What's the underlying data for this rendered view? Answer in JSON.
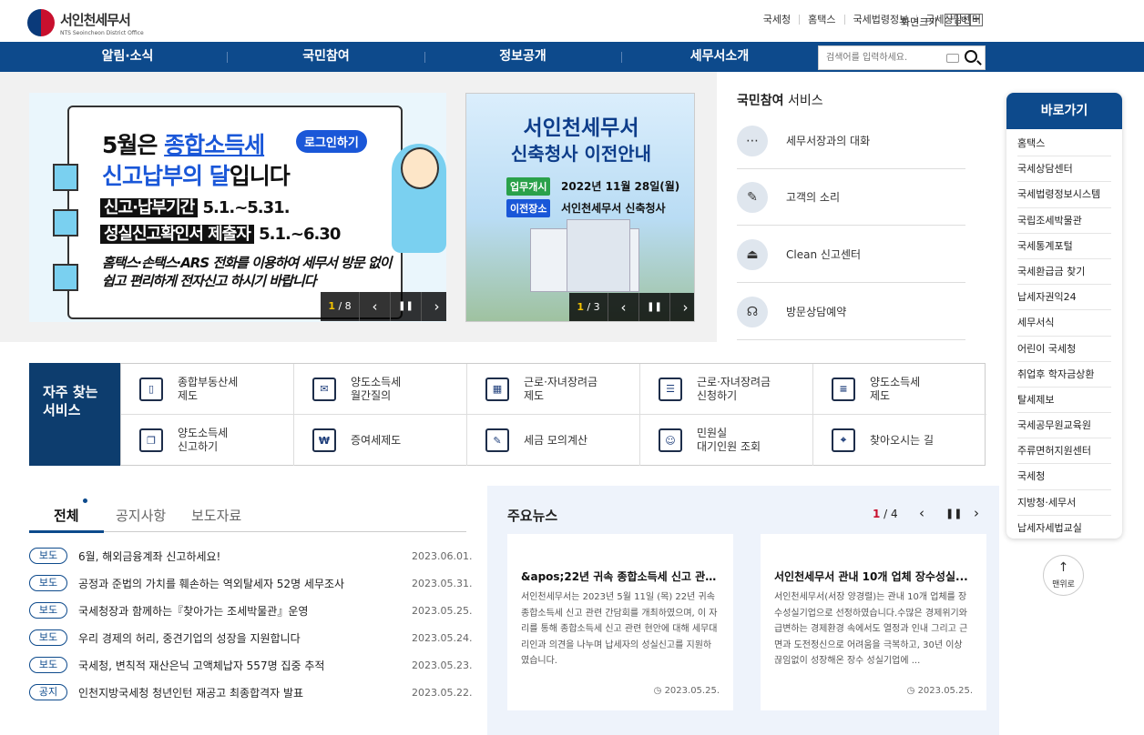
{
  "header": {
    "logo_title": "서인천세무서",
    "logo_sub": "NTS Seoincheon District Office",
    "util": [
      "국세청",
      "홈택스",
      "국세법령정보",
      "국세상담센터"
    ],
    "zoom_label": "화면크기",
    "zoom_buttons": [
      "−",
      "o",
      "+"
    ]
  },
  "nav": {
    "items": [
      "알림·소식",
      "국민참여",
      "정보공개",
      "세무서소개"
    ],
    "search_placeholder": "검색어를 입력하세요."
  },
  "banner1": {
    "line1a": "5월은 ",
    "line1b": "종합소득세",
    "login": "로그인하기",
    "line2a": "신고납부의 달",
    "line2b": "입니다",
    "row1a": "신고·납부기간",
    "row1b": " 5.1.~5.31.",
    "row2a": "성실신고확인서 제출자",
    "row2b": " 5.1.~6.30",
    "desc": "홈택스·손택스·ARS 전화를 이용하여 세무서 방문 없이 쉽고 편리하게 전자신고 하시기 바랍니다",
    "cur": "1",
    "total": "8"
  },
  "banner2": {
    "title1": "서인천세무서",
    "title2": "신축청사 이전안내",
    "tag1": "업무개시",
    "text1": "2022년 11월 28일(월)",
    "tag2": "이전장소",
    "text2": "서인천세무서 신축청사",
    "cur": "1",
    "total": "3"
  },
  "controls": {
    "prev": "‹",
    "pause": "❚❚",
    "next": "›"
  },
  "participation": {
    "title_bold": "국민참여",
    "title_rest": " 서비스",
    "items": [
      {
        "label": "세무서장과의 대화",
        "icon": "chat-icon",
        "glyph": "⋯"
      },
      {
        "label": "고객의 소리",
        "icon": "pencil-icon",
        "glyph": "✎"
      },
      {
        "label": "Clean 신고센터",
        "icon": "siren-icon",
        "glyph": "⏏"
      },
      {
        "label": "방문상담예약",
        "icon": "headset-icon",
        "glyph": "☊"
      }
    ]
  },
  "shortcut": {
    "title": "바로가기",
    "items": [
      "홈택스",
      "국세상담센터",
      "국세법령정보시스템",
      "국립조세박물관",
      "국세통계포털",
      "국세환급금 찾기",
      "납세자권익24",
      "세무서식",
      "어린이 국세청",
      "취업후 학자금상환",
      "탈세제보",
      "국세공무원교육원",
      "주류면허지원센터",
      "국세청",
      "지방청·세무서",
      "납세자세법교실"
    ]
  },
  "top": {
    "arrow": "↑",
    "label": "맨위로"
  },
  "frequent": {
    "title": "자주 찾는\n서비스",
    "items": [
      {
        "label": "종합부동산세\n제도",
        "icon": "bookmark-icon",
        "glyph": "▯"
      },
      {
        "label": "양도소득세\n월간질의",
        "icon": "monitor-icon",
        "glyph": "✉"
      },
      {
        "label": "근로·자녀장려금\n제도",
        "icon": "calculator-icon",
        "glyph": "▦"
      },
      {
        "label": "근로·자녀장려금\n신청하기",
        "icon": "clipboard-icon",
        "glyph": "☰"
      },
      {
        "label": "양도소득세\n제도",
        "icon": "document-icon",
        "glyph": "≡"
      },
      {
        "label": "양도소득세\n신고하기",
        "icon": "documents-icon",
        "glyph": "❐"
      },
      {
        "label": "증여세제도",
        "icon": "hand-coin-icon",
        "glyph": "₩"
      },
      {
        "label": "세금 모의계산",
        "icon": "form-pen-icon",
        "glyph": "✎"
      },
      {
        "label": "민원실\n대기인원 조회",
        "icon": "people-icon",
        "glyph": "☺"
      },
      {
        "label": "찾아오시는 길",
        "icon": "map-pin-icon",
        "glyph": "⌖"
      }
    ]
  },
  "notice": {
    "tabs": [
      "전체",
      "공지사항",
      "보도자료"
    ],
    "rows": [
      {
        "badge": "보도",
        "title": "6월, 해외금융계좌 신고하세요!",
        "date": "2023.06.01."
      },
      {
        "badge": "보도",
        "title": "공정과 준법의 가치를 훼손하는 역외탈세자 52명 세무조사",
        "date": "2023.05.31."
      },
      {
        "badge": "보도",
        "title": "국세청장과 함께하는『찾아가는 조세박물관』운영",
        "date": "2023.05.25."
      },
      {
        "badge": "보도",
        "title": "우리 경제의 허리, 중견기업의 성장을 지원합니다",
        "date": "2023.05.24."
      },
      {
        "badge": "보도",
        "title": "국세청, 변칙적 재산은닉 고액체납자 557명 집중 추적",
        "date": "2023.05.23."
      },
      {
        "badge": "공지",
        "title": "인천지방국세청 청년인턴 재공고 최종합격자 발표",
        "date": "2023.05.22."
      }
    ]
  },
  "news": {
    "title": "주요뉴스",
    "cur": "1",
    "total": " / 4",
    "cards": [
      {
        "title": "&apos;22년 귀속 종합소득세 신고 관련...",
        "body": "서인천세무서는 2023년 5월 11일 (목) 22년 귀속 종합소득세 신고 관련 간담회를 개최하였으며, 이 자리를 통해 종합소득세 신고 관련 현안에 대해 세무대리인과 의견을 나누며 납세자의 성실신고를 지원하였습니다.",
        "date": "2023.05.25."
      },
      {
        "title": "서인천세무서 관내 10개 업체 장수성실...",
        "body": "서인천세무서(서장 양경렬)는 관내 10개 업체를 장수성실기업으로 선정하였습니다.수많은 경제위기와 급변하는 경제환경 속에서도 열정과 인내 그리고 근면과 도전정신으로 어려움을 극복하고, 30년 이상 끊임없이 성장해온 장수 성실기업에 ...",
        "date": "2023.05.25."
      }
    ]
  }
}
